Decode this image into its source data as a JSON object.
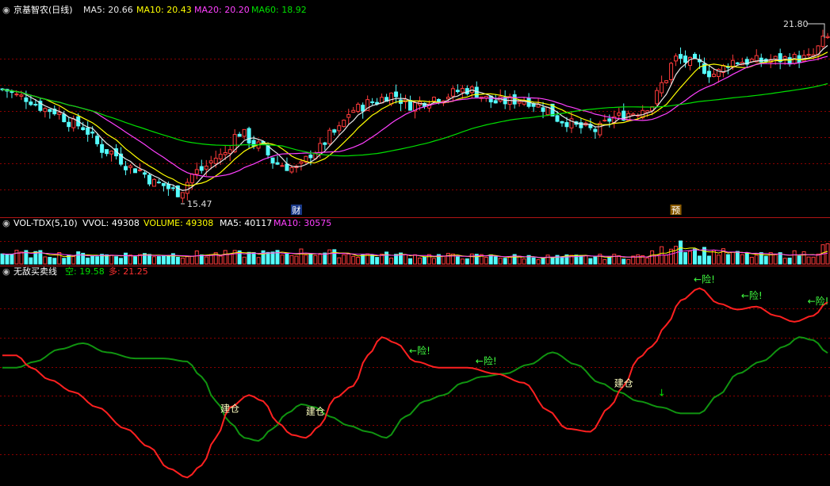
{
  "colors": {
    "background": "#000000",
    "grid": "#8b0000",
    "divider": "#b01414",
    "up": "#ff3b3b",
    "down": "#54fcfc",
    "ma5": "#e8e8e8",
    "ma10": "#ffff00",
    "ma20": "#ff40ff",
    "ma60": "#00e000",
    "bull": "#ff2020",
    "bear": "#109410",
    "buy_text": "#ffffc0",
    "warn_text": "#40ff40",
    "arrow_green": "#00e000"
  },
  "header": {
    "stock_name": "京基智农(日线)",
    "ma5_label": "MA5: 20.66",
    "ma10_label": "MA10: 20.43",
    "ma20_label": "MA20: 20.20",
    "ma60_label": "MA60: 18.92"
  },
  "price_labels": {
    "high": "21.80",
    "low": "15.47"
  },
  "event_markers": [
    {
      "text": "财",
      "index": 62
    },
    {
      "text": "预",
      "index": 142
    }
  ],
  "volume_header": {
    "indicator": "VOL-TDX(5,10)",
    "vvol": "VVOL: 49308",
    "volume": "VOLUME: 49308",
    "ma5": "MA5: 40117",
    "ma10": "MA10: 30575"
  },
  "indicator_header": {
    "name": "无敌买卖线",
    "kong": "空: 19.58",
    "duo": "多: 21.25"
  },
  "indicator_marks": [
    {
      "text": "建仓",
      "index": 48,
      "type": "buy"
    },
    {
      "text": "建仓",
      "index": 66,
      "type": "buy"
    },
    {
      "text": "←险!",
      "index": 88,
      "type": "warn"
    },
    {
      "text": "←险!",
      "index": 102,
      "type": "warn"
    },
    {
      "text": "建仓",
      "index": 131,
      "type": "buy"
    },
    {
      "text": "↓",
      "index": 139,
      "type": "arrow"
    },
    {
      "text": "←险!",
      "index": 148,
      "type": "warn"
    },
    {
      "text": "←险!",
      "index": 158,
      "type": "warn"
    },
    {
      "text": "←险!",
      "index": 172,
      "type": "warn"
    }
  ],
  "chart_data": {
    "type": "candlestick",
    "bar_count": 175,
    "price_ylim": [
      15.0,
      22.6
    ],
    "volume_ylim": [
      0,
      100000
    ],
    "indicator_ylim": [
      15.3,
      22.0
    ],
    "price_keys": [
      [
        0,
        19.8
      ],
      [
        4,
        19.5
      ],
      [
        10,
        19.0
      ],
      [
        16,
        18.4
      ],
      [
        22,
        17.4
      ],
      [
        28,
        16.7
      ],
      [
        33,
        16.1
      ],
      [
        37,
        15.8
      ],
      [
        41,
        16.6
      ],
      [
        46,
        17.2
      ],
      [
        50,
        18.1
      ],
      [
        54,
        17.6
      ],
      [
        58,
        16.9
      ],
      [
        62,
        16.7
      ],
      [
        66,
        17.4
      ],
      [
        70,
        18.1
      ],
      [
        74,
        19.0
      ],
      [
        78,
        19.3
      ],
      [
        82,
        19.6
      ],
      [
        86,
        19.2
      ],
      [
        92,
        19.5
      ],
      [
        98,
        19.8
      ],
      [
        104,
        19.3
      ],
      [
        110,
        19.4
      ],
      [
        114,
        19.1
      ],
      [
        118,
        18.6
      ],
      [
        122,
        18.3
      ],
      [
        125,
        18.2
      ],
      [
        129,
        18.7
      ],
      [
        133,
        18.9
      ],
      [
        137,
        19.2
      ],
      [
        139,
        20.0
      ],
      [
        142,
        21.0
      ],
      [
        146,
        20.8
      ],
      [
        150,
        20.4
      ],
      [
        154,
        20.9
      ],
      [
        160,
        20.9
      ],
      [
        166,
        21.0
      ],
      [
        170,
        21.0
      ],
      [
        174,
        21.8
      ]
    ],
    "volume_keys": [
      [
        0,
        30000
      ],
      [
        20,
        26000
      ],
      [
        40,
        28000
      ],
      [
        60,
        30000
      ],
      [
        62,
        34000
      ],
      [
        80,
        26000
      ],
      [
        100,
        22000
      ],
      [
        120,
        20000
      ],
      [
        135,
        22000
      ],
      [
        140,
        40000
      ],
      [
        142,
        72000
      ],
      [
        146,
        38000
      ],
      [
        160,
        24000
      ],
      [
        170,
        30000
      ],
      [
        174,
        49308
      ]
    ],
    "duo_keys": [
      [
        0,
        19.5
      ],
      [
        3,
        19.5
      ],
      [
        6,
        19.1
      ],
      [
        10,
        18.7
      ],
      [
        15,
        18.3
      ],
      [
        20,
        17.8
      ],
      [
        26,
        17.1
      ],
      [
        31,
        16.5
      ],
      [
        35,
        15.8
      ],
      [
        39,
        15.5
      ],
      [
        42,
        15.9
      ],
      [
        45,
        16.8
      ],
      [
        48,
        17.8
      ],
      [
        52,
        18.2
      ],
      [
        55,
        18.0
      ],
      [
        58,
        17.3
      ],
      [
        61,
        16.9
      ],
      [
        64,
        16.8
      ],
      [
        67,
        17.2
      ],
      [
        70,
        18.1
      ],
      [
        74,
        18.5
      ],
      [
        77,
        19.5
      ],
      [
        80,
        20.1
      ],
      [
        83,
        19.9
      ],
      [
        87,
        19.3
      ],
      [
        92,
        19.1
      ],
      [
        98,
        19.1
      ],
      [
        104,
        18.9
      ],
      [
        110,
        18.6
      ],
      [
        115,
        17.7
      ],
      [
        119,
        17.1
      ],
      [
        124,
        17.0
      ],
      [
        128,
        17.8
      ],
      [
        131,
        18.5
      ],
      [
        134,
        19.4
      ],
      [
        137,
        19.8
      ],
      [
        140,
        20.5
      ],
      [
        143,
        21.3
      ],
      [
        147,
        21.7
      ],
      [
        151,
        21.2
      ],
      [
        155,
        21.0
      ],
      [
        159,
        21.1
      ],
      [
        163,
        20.8
      ],
      [
        167,
        20.6
      ],
      [
        171,
        20.8
      ],
      [
        174,
        21.25
      ]
    ],
    "kong_keys": [
      [
        0,
        19.1
      ],
      [
        3,
        19.1
      ],
      [
        7,
        19.3
      ],
      [
        12,
        19.7
      ],
      [
        17,
        19.9
      ],
      [
        22,
        19.6
      ],
      [
        28,
        19.4
      ],
      [
        34,
        19.4
      ],
      [
        39,
        19.3
      ],
      [
        42,
        18.8
      ],
      [
        45,
        18.0
      ],
      [
        48,
        17.3
      ],
      [
        51,
        16.8
      ],
      [
        54,
        16.7
      ],
      [
        57,
        17.1
      ],
      [
        60,
        17.6
      ],
      [
        63,
        17.9
      ],
      [
        66,
        17.8
      ],
      [
        69,
        17.5
      ],
      [
        73,
        17.2
      ],
      [
        77,
        17.0
      ],
      [
        81,
        16.8
      ],
      [
        85,
        17.5
      ],
      [
        89,
        18.0
      ],
      [
        93,
        18.2
      ],
      [
        97,
        18.6
      ],
      [
        101,
        18.8
      ],
      [
        106,
        18.9
      ],
      [
        111,
        19.2
      ],
      [
        116,
        19.6
      ],
      [
        121,
        19.2
      ],
      [
        126,
        18.6
      ],
      [
        130,
        18.3
      ],
      [
        134,
        18.0
      ],
      [
        139,
        17.8
      ],
      [
        143,
        17.6
      ],
      [
        147,
        17.6
      ],
      [
        151,
        18.2
      ],
      [
        155,
        18.9
      ],
      [
        160,
        19.3
      ],
      [
        165,
        19.8
      ],
      [
        168,
        20.1
      ],
      [
        171,
        20.0
      ],
      [
        174,
        19.58
      ]
    ]
  }
}
